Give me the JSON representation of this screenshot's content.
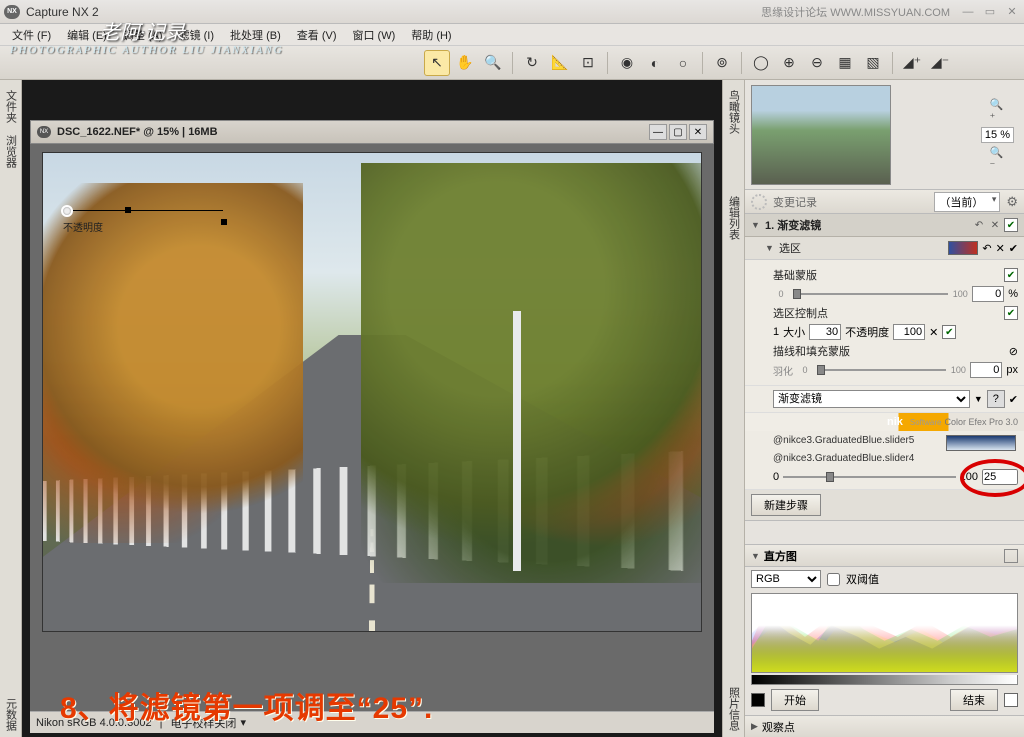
{
  "titlebar": {
    "app_name": "Capture NX 2",
    "watermark": "思缘设计论坛  WWW.MISSYUAN.COM"
  },
  "menubar": {
    "items": [
      "文件 (F)",
      "编辑 (E)",
      "调整 (A)",
      "滤镜 (I)",
      "批处理 (B)",
      "查看 (V)",
      "窗口 (W)",
      "帮助 (H)"
    ],
    "overlay": "老阿·记录",
    "subtitle": "PHOTOGRAPHIC AUTHOR LIU JIANXIANG"
  },
  "sidecols": {
    "left1": "文件夹",
    "left2": "浏览器",
    "left3": "元数据",
    "right1": "鸟瞰镜头",
    "right2": "编辑列表",
    "right3": "照片信息"
  },
  "doc": {
    "title": "DSC_1622.NEF* @ 15% | 16MB",
    "cp_label": "不透明度"
  },
  "status": {
    "profile": "Nikon sRGB 4.0.0.3002",
    "softproof": "电子校样关闭"
  },
  "navigator": {
    "zoom_value": "15",
    "zoom_unit": "%"
  },
  "history": {
    "label": "变更记录",
    "combo": "（当前）"
  },
  "step1": {
    "name": "1. 渐变滤镜"
  },
  "selection": {
    "label": "选区",
    "base_mask": "基础蒙版",
    "base_max": "100",
    "base_val": "0",
    "base_unit": "%",
    "control_point": "选区控制点",
    "cp_num": "1",
    "cp_size_label": "大小",
    "cp_size": "30",
    "cp_opacity_label": "不透明度",
    "cp_opacity": "100",
    "stroke_fill": "描线和填充蒙版",
    "feather": "羽化",
    "feather_max": "100",
    "feather_val": "0",
    "feather_unit": "px"
  },
  "filter": {
    "dropdown": "渐变滤镜",
    "plugin_brand": "nik",
    "plugin_soft": "Software",
    "plugin_name": "Color Efex Pro 3.0",
    "name1": "@nikce3.GraduatedBlue.slider5",
    "name2": "@nikce3.GraduatedBlue.slider4",
    "s_min": "0",
    "s_max": "100",
    "s_val": "25"
  },
  "newstep": "新建步骤",
  "histogram": {
    "title": "直方图",
    "channel": "RGB",
    "dual": "双阈值",
    "start": "开始",
    "end": "结束"
  },
  "watchpoint": "观察点",
  "instruction": "8、将滤镜第一项调至“25”."
}
